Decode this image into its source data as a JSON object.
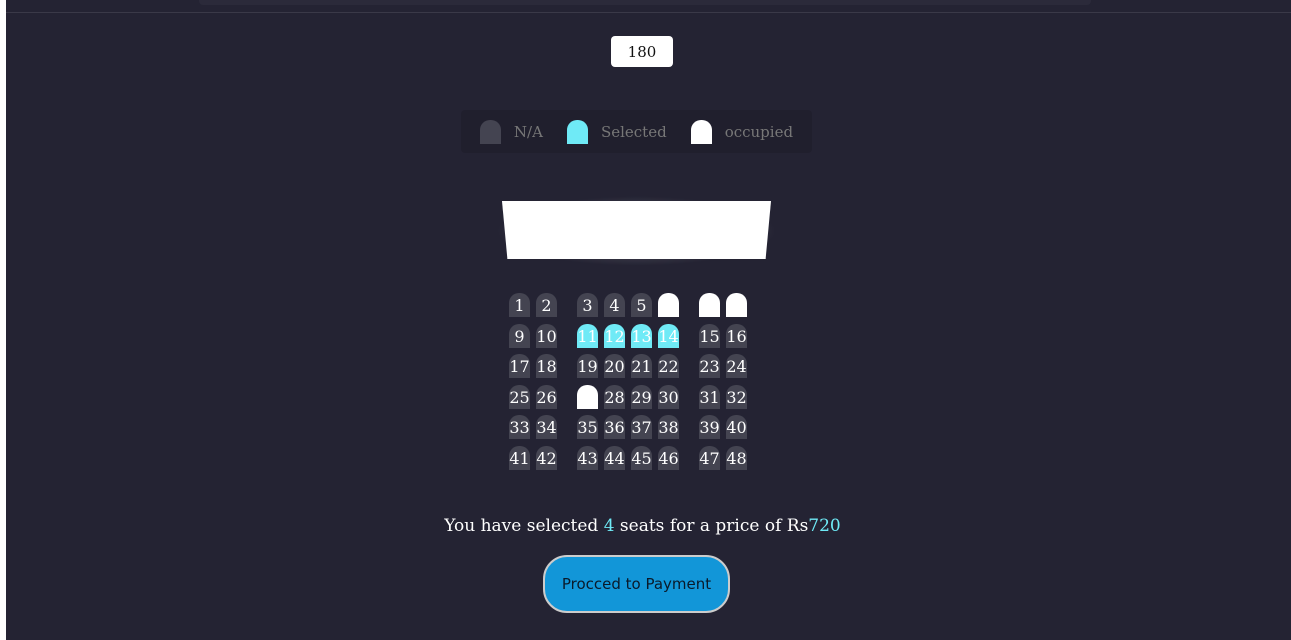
{
  "price_input": {
    "value": "180"
  },
  "legend": {
    "items": [
      {
        "label": "N/A",
        "color": "#444451"
      },
      {
        "label": "Selected",
        "color": "#6feaf6"
      },
      {
        "label": "occupied",
        "color": "#ffffff"
      }
    ]
  },
  "seats": {
    "rows": [
      [
        {
          "label": "1",
          "state": "na"
        },
        {
          "label": "2",
          "state": "na"
        },
        {
          "label": "3",
          "state": "na"
        },
        {
          "label": "4",
          "state": "na"
        },
        {
          "label": "5",
          "state": "na"
        },
        {
          "label": "",
          "state": "occupied"
        },
        {
          "label": "",
          "state": "occupied"
        },
        {
          "label": "",
          "state": "occupied"
        }
      ],
      [
        {
          "label": "9",
          "state": "na"
        },
        {
          "label": "10",
          "state": "na"
        },
        {
          "label": "11",
          "state": "selected"
        },
        {
          "label": "12",
          "state": "selected"
        },
        {
          "label": "13",
          "state": "selected"
        },
        {
          "label": "14",
          "state": "selected"
        },
        {
          "label": "15",
          "state": "na"
        },
        {
          "label": "16",
          "state": "na"
        }
      ],
      [
        {
          "label": "17",
          "state": "na"
        },
        {
          "label": "18",
          "state": "na"
        },
        {
          "label": "19",
          "state": "na"
        },
        {
          "label": "20",
          "state": "na"
        },
        {
          "label": "21",
          "state": "na"
        },
        {
          "label": "22",
          "state": "na"
        },
        {
          "label": "23",
          "state": "na"
        },
        {
          "label": "24",
          "state": "na"
        }
      ],
      [
        {
          "label": "25",
          "state": "na"
        },
        {
          "label": "26",
          "state": "na"
        },
        {
          "label": "",
          "state": "occupied"
        },
        {
          "label": "28",
          "state": "na"
        },
        {
          "label": "29",
          "state": "na"
        },
        {
          "label": "30",
          "state": "na"
        },
        {
          "label": "31",
          "state": "na"
        },
        {
          "label": "32",
          "state": "na"
        }
      ],
      [
        {
          "label": "33",
          "state": "na"
        },
        {
          "label": "34",
          "state": "na"
        },
        {
          "label": "35",
          "state": "na"
        },
        {
          "label": "36",
          "state": "na"
        },
        {
          "label": "37",
          "state": "na"
        },
        {
          "label": "38",
          "state": "na"
        },
        {
          "label": "39",
          "state": "na"
        },
        {
          "label": "40",
          "state": "na"
        }
      ],
      [
        {
          "label": "41",
          "state": "na"
        },
        {
          "label": "42",
          "state": "na"
        },
        {
          "label": "43",
          "state": "na"
        },
        {
          "label": "44",
          "state": "na"
        },
        {
          "label": "45",
          "state": "na"
        },
        {
          "label": "46",
          "state": "na"
        },
        {
          "label": "47",
          "state": "na"
        },
        {
          "label": "48",
          "state": "na"
        }
      ]
    ]
  },
  "summary": {
    "prefix": "You have selected ",
    "count": "4",
    "middle": " seats for a price of Rs",
    "total": "720"
  },
  "pay_button": {
    "label": "Procced to Payment"
  },
  "colors": {
    "background": "#242333",
    "seat_na": "#444451",
    "seat_selected": "#6feaf6",
    "seat_occupied": "#ffffff",
    "button": "#1296d8"
  }
}
